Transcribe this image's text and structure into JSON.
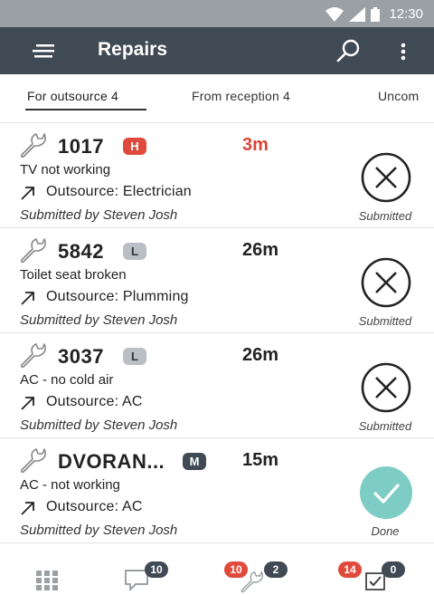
{
  "status_bar": {
    "time": "12:30"
  },
  "app_bar": {
    "title": "Repairs"
  },
  "tabs": [
    {
      "label": "For outsource 4",
      "active": true
    },
    {
      "label": "From reception 4",
      "active": false
    },
    {
      "label": "Uncom",
      "active": false
    }
  ],
  "repairs": [
    {
      "id": "1017",
      "priority": "H",
      "priority_color": "#e04a3c",
      "elapsed": "3m",
      "elapsed_color": "#d9453a",
      "problem": "TV not working",
      "outsource": "Outsource: Electrician",
      "submitted_by": "Submitted by Steven Josh",
      "status": "Submitted",
      "status_icon": "close-circle-icon"
    },
    {
      "id": "5842",
      "priority": "L",
      "priority_color": "#b9bfc4",
      "elapsed": "26m",
      "elapsed_color": "#222222",
      "problem": "Toilet seat broken",
      "outsource": "Outsource: Plumming",
      "submitted_by": "Submitted by Steven Josh",
      "status": "Submitted",
      "status_icon": "close-circle-icon"
    },
    {
      "id": "3037",
      "priority": "L",
      "priority_color": "#b9bfc4",
      "elapsed": "26m",
      "elapsed_color": "#222222",
      "problem": "AC - no cold air",
      "outsource": "Outsource: AC",
      "submitted_by": "Submitted by Steven Josh",
      "status": "Submitted",
      "status_icon": "close-circle-icon"
    },
    {
      "id": "DVORAN...",
      "priority": "M",
      "priority_color": "#404a54",
      "elapsed": "15m",
      "elapsed_color": "#222222",
      "problem": "AC - not working",
      "outsource": "Outsource: AC",
      "submitted_by": "Submitted by Steven Josh",
      "status": "Done",
      "status_icon": "check-circle-icon"
    }
  ],
  "bottom_nav": {
    "messages_badge": "10",
    "repairs_badge_red": "10",
    "repairs_badge_dark": "2",
    "tasks_badge_red": "14",
    "tasks_badge_dark": "0"
  },
  "colors": {
    "app_bar": "#404a54",
    "status_bar": "#9aa0a4",
    "done_teal": "#7ecdc5",
    "badge_red": "#e04a3c",
    "badge_dark": "#404a54"
  }
}
